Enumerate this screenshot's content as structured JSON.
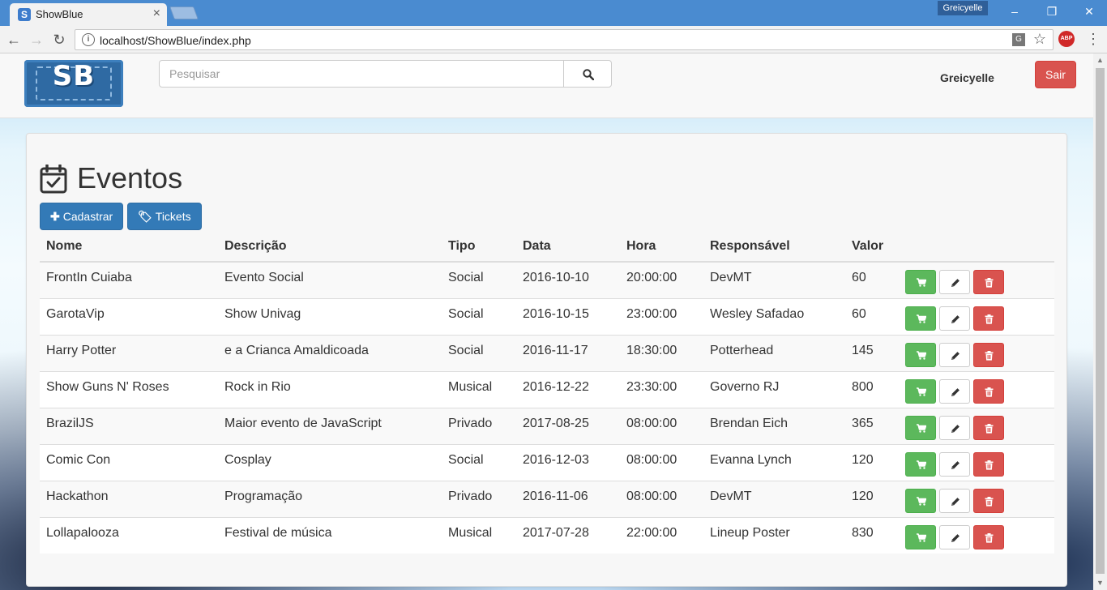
{
  "browser": {
    "tab_title": "ShowBlue",
    "tab_close": "×",
    "profile_name": "Greicyelle",
    "url": "localhost/ShowBlue/index.php",
    "window_controls": [
      "–",
      "❐",
      "✕"
    ]
  },
  "header": {
    "logo_text": "SB",
    "search_placeholder": "Pesquisar",
    "username": "Greicyelle",
    "logout_label": "Sair"
  },
  "main": {
    "title": "Eventos",
    "buttons": [
      {
        "label": "Cadastrar",
        "icon": "plus-icon"
      },
      {
        "label": "Tickets",
        "icon": "tag-icon"
      }
    ],
    "table": {
      "columns": [
        "Nome",
        "Descrição",
        "Tipo",
        "Data",
        "Hora",
        "Responsável",
        "Valor"
      ],
      "rows": [
        {
          "nome": "FrontIn Cuiaba",
          "descricao": "Evento Social",
          "tipo": "Social",
          "data": "2016-10-10",
          "hora": "20:00:00",
          "responsavel": "DevMT",
          "valor": "60"
        },
        {
          "nome": "GarotaVip",
          "descricao": "Show Univag",
          "tipo": "Social",
          "data": "2016-10-15",
          "hora": "23:00:00",
          "responsavel": "Wesley Safadao",
          "valor": "60"
        },
        {
          "nome": "Harry Potter",
          "descricao": "e a Crianca Amaldicoada",
          "tipo": "Social",
          "data": "2016-11-17",
          "hora": "18:30:00",
          "responsavel": "Potterhead",
          "valor": "145"
        },
        {
          "nome": "Show Guns N' Roses",
          "descricao": "Rock in Rio",
          "tipo": "Musical",
          "data": "2016-12-22",
          "hora": "23:30:00",
          "responsavel": "Governo RJ",
          "valor": "800"
        },
        {
          "nome": "BrazilJS",
          "descricao": "Maior evento de JavaScript",
          "tipo": "Privado",
          "data": "2017-08-25",
          "hora": "08:00:00",
          "responsavel": "Brendan Eich",
          "valor": "365"
        },
        {
          "nome": "Comic Con",
          "descricao": "Cosplay",
          "tipo": "Social",
          "data": "2016-12-03",
          "hora": "08:00:00",
          "responsavel": "Evanna Lynch",
          "valor": "120"
        },
        {
          "nome": "Hackathon",
          "descricao": "Programação",
          "tipo": "Privado",
          "data": "2016-11-06",
          "hora": "08:00:00",
          "responsavel": "DevMT",
          "valor": "120"
        },
        {
          "nome": "Lollapalooza",
          "descricao": "Festival de música",
          "tipo": "Musical",
          "data": "2017-07-28",
          "hora": "22:00:00",
          "responsavel": "Lineup Poster",
          "valor": "830"
        }
      ],
      "row_actions": [
        "cart-icon",
        "pencil-icon",
        "trash-icon"
      ]
    }
  },
  "colors": {
    "primary": "#337ab7",
    "success": "#5cb85c",
    "danger": "#d9534f",
    "chrome_titlebar": "#4a8bd0"
  }
}
